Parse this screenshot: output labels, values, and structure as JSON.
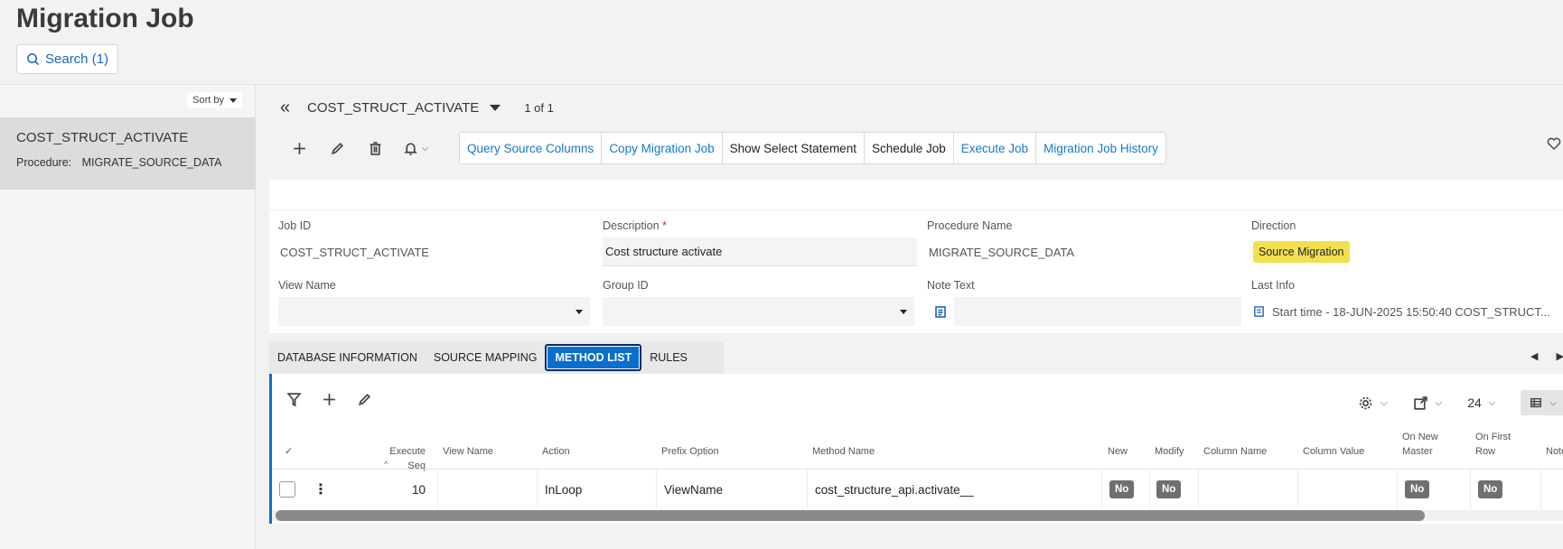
{
  "page": {
    "title": "Migration Job"
  },
  "search": {
    "label": "Search (1)"
  },
  "list": {
    "sort_label": "Sort by",
    "items": [
      {
        "title": "COST_STRUCT_ACTIVATE",
        "sub_label": "Procedure:",
        "sub_value": "MIGRATE_SOURCE_DATA"
      }
    ]
  },
  "detail": {
    "record_title": "COST_STRUCT_ACTIVATE",
    "pager": "1 of 1"
  },
  "toolbar": {
    "buttons": [
      "Query Source Columns",
      "Copy Migration Job",
      "Show Select Statement",
      "Schedule Job",
      "Execute Job",
      "Migration Job History"
    ]
  },
  "form": {
    "job_id_label": "Job ID",
    "job_id_value": "COST_STRUCT_ACTIVATE",
    "description_label": "Description",
    "description_required": "*",
    "description_value": "Cost structure activate",
    "procedure_label": "Procedure Name",
    "procedure_value": "MIGRATE_SOURCE_DATA",
    "direction_label": "Direction",
    "direction_value": "Source Migration",
    "view_name_label": "View Name",
    "group_id_label": "Group ID",
    "note_text_label": "Note Text",
    "last_info_label": "Last Info",
    "last_info_value": "Start time - 18-JUN-2025 15:50:40   COST_STRUCT..."
  },
  "tabs": [
    "DATABASE INFORMATION",
    "SOURCE MAPPING",
    "METHOD LIST",
    "RULES"
  ],
  "grid": {
    "page_size": "24",
    "columns": {
      "execute_seq": "Execute Seq",
      "view_name": "View Name",
      "action": "Action",
      "prefix_option": "Prefix Option",
      "method_name": "Method Name",
      "new": "New",
      "modify": "Modify",
      "column_name": "Column Name",
      "column_value": "Column Value",
      "on_new_master_1": "On New",
      "on_new_master_2": "Master",
      "on_first_row_1": "On First",
      "on_first_row_2": "Row",
      "notes": "Note"
    },
    "rows": [
      {
        "execute_seq": "10",
        "view_name": "",
        "action": "InLoop",
        "prefix_option": "ViewName",
        "method_name": "cost_structure_api.activate__",
        "new": "No",
        "modify": "No",
        "column_name": "",
        "column_value": "",
        "on_new_master": "No",
        "on_first_row": "No"
      }
    ]
  },
  "colors": {
    "accent": "#0a6ecf",
    "link": "#1976c9",
    "badge_yellow": "#f3e04f",
    "badge_gray": "#6f6f6f"
  }
}
